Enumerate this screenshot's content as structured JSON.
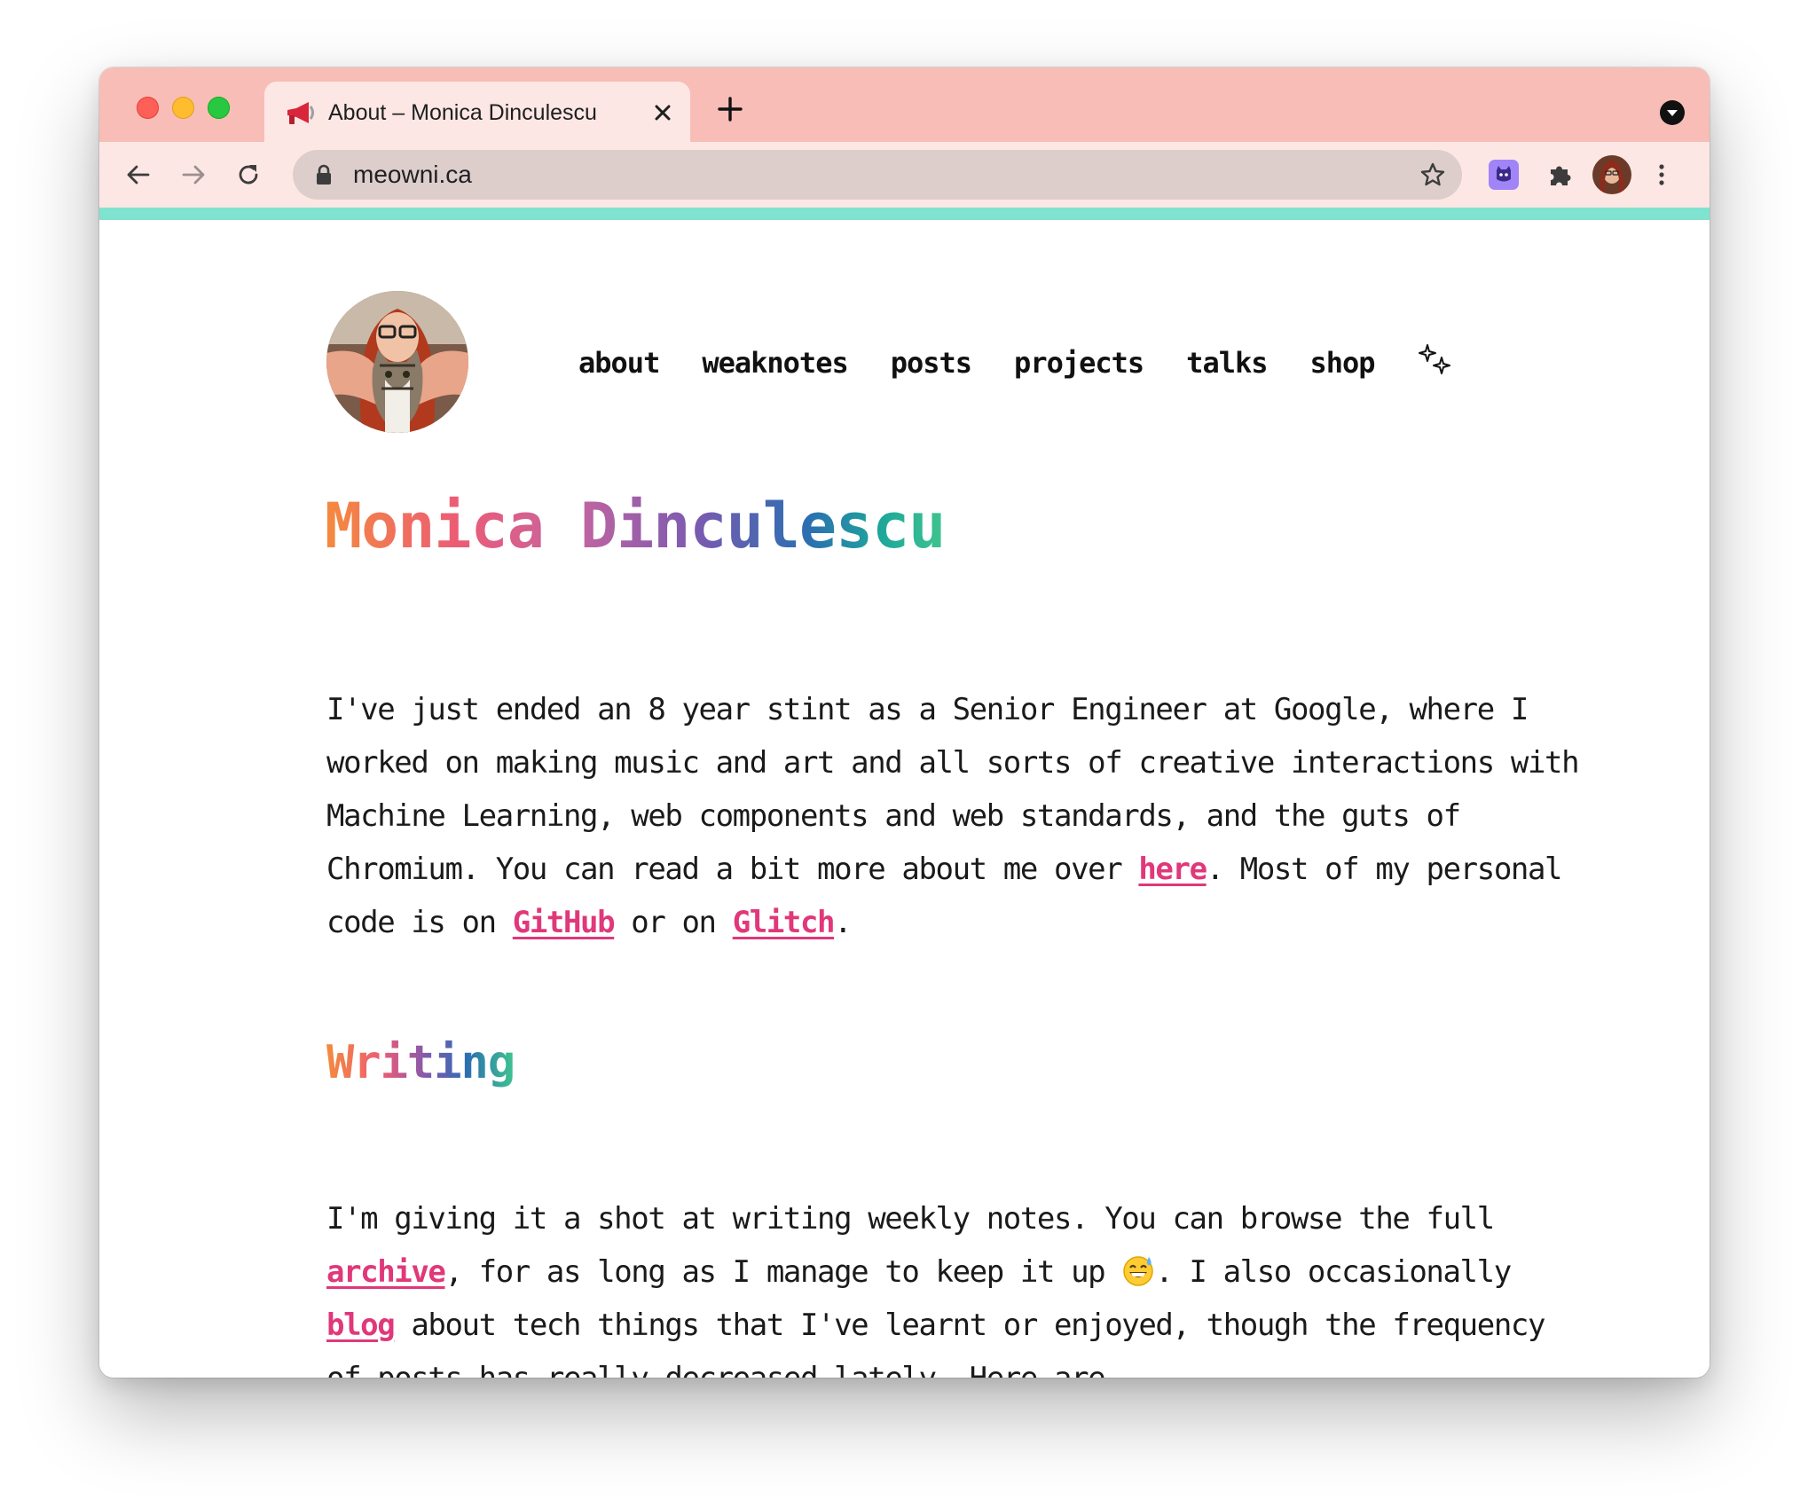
{
  "browser": {
    "tab_title": "About – Monica Dinculescu",
    "url": "meowni.ca",
    "icons": {
      "tab_favicon": "megaphone-icon",
      "close": "close-icon",
      "new_tab": "plus-icon",
      "tab_search": "chevron-down-circle-icon",
      "back": "arrow-left-icon",
      "forward": "arrow-right-icon",
      "reload": "reload-icon",
      "lock": "lock-icon",
      "bookmark": "star-icon",
      "extension_cat": "cat-extension-icon",
      "extensions": "puzzle-icon",
      "menu": "kebab-menu-icon"
    },
    "colors": {
      "tabstrip": "#f8bdb6",
      "toolbar": "#fde7e4",
      "accent_bar": "#7fe3cf"
    }
  },
  "page": {
    "nav": {
      "items": [
        "about",
        "weaknotes",
        "posts",
        "projects",
        "talks",
        "shop"
      ],
      "sparkle": "sparkle-icon"
    },
    "title": "Monica Dinculescu",
    "intro": {
      "t1": "I've just ended an 8 year stint as a Senior Engineer at Google, where I worked on making music and art and all sorts of creative interactions with Machine Learning, web components and web standards, and the guts of Chromium. You can read a bit more about me over ",
      "link_here": "here",
      "t2": ". Most of my personal code is on ",
      "link_github": "GitHub",
      "t3": " or on ",
      "link_glitch": "Glitch",
      "t4": "."
    },
    "writing": {
      "heading": "Writing",
      "t1": "I'm giving it a shot at writing weekly notes. You can browse the full ",
      "link_archive": "archive",
      "t2": ", for as long as I manage to keep it up ",
      "emoji": "grinning-sweat-emoji",
      "t3": ". I also occasionally ",
      "link_blog": "blog",
      "t4": " about tech things that I've learnt or enjoyed, though the frequency of posts has really decreased lately. Here are"
    },
    "colors": {
      "link": "#e0387a",
      "text": "#1a1a1a"
    }
  }
}
